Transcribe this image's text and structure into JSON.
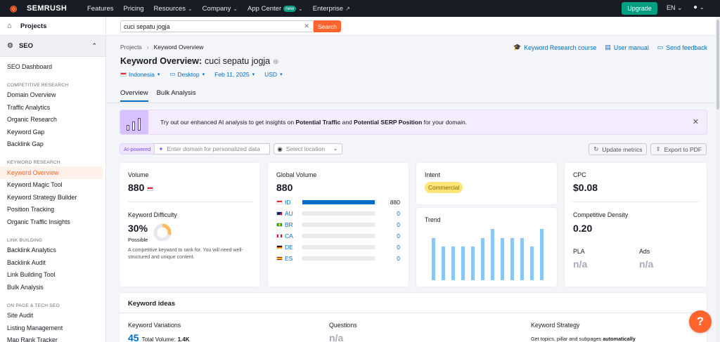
{
  "topbar": {
    "brand": "SEMRUSH",
    "nav": [
      {
        "label": "Features",
        "dropdown": false
      },
      {
        "label": "Pricing",
        "dropdown": false
      },
      {
        "label": "Resources",
        "dropdown": true
      },
      {
        "label": "Company",
        "dropdown": true
      },
      {
        "label": "App Center",
        "dropdown": true,
        "badge": "new"
      },
      {
        "label": "Enterprise",
        "dropdown": false
      }
    ],
    "upgrade_label": "Upgrade",
    "lang": "EN"
  },
  "sidebar": {
    "projects": "Projects",
    "seo": "SEO",
    "top_items": [
      "SEO Dashboard"
    ],
    "sections": [
      {
        "title": "COMPETITIVE RESEARCH",
        "items": [
          "Domain Overview",
          "Traffic Analytics",
          "Organic Research",
          "Keyword Gap",
          "Backlink Gap"
        ]
      },
      {
        "title": "KEYWORD RESEARCH",
        "items": [
          "Keyword Overview",
          "Keyword Magic Tool",
          "Keyword Strategy Builder",
          "Position Tracking",
          "Organic Traffic Insights"
        ]
      },
      {
        "title": "LINK BUILDING",
        "items": [
          "Backlink Analytics",
          "Backlink Audit",
          "Link Building Tool",
          "Bulk Analysis"
        ]
      },
      {
        "title": "ON PAGE & TECH SEO",
        "items": [
          "Site Audit",
          "Listing Management",
          "Map Rank Tracker"
        ]
      }
    ],
    "active_item": "Keyword Overview"
  },
  "search": {
    "value": "cuci sepatu jogja",
    "button": "Search"
  },
  "breadcrumb": {
    "parent": "Projects",
    "current": "Keyword Overview"
  },
  "toplinks": {
    "course": "Keyword Research course",
    "manual": "User manual",
    "feedback": "Send feedback"
  },
  "page": {
    "title": "Keyword Overview:",
    "keyword": "cuci sepatu jogja"
  },
  "filters": {
    "country": "Indonesia",
    "device": "Desktop",
    "date": "Feb 11, 2025",
    "currency": "USD"
  },
  "tabs": [
    "Overview",
    "Bulk Analysis"
  ],
  "banner": {
    "pre": "Try out our enhanced AI analysis to get insights on ",
    "b1": "Potential Traffic",
    "mid": " and ",
    "b2": "Potential SERP Position",
    "post": " for your domain."
  },
  "ai": {
    "pill": "AI-powered",
    "placeholder": "Enter domain for personalized data",
    "location": "Select location"
  },
  "actions": {
    "update": "Update metrics",
    "export": "Export to PDF"
  },
  "volume": {
    "label": "Volume",
    "value": "880"
  },
  "difficulty": {
    "label": "Keyword Difficulty",
    "value": "30%",
    "level": "Possible",
    "percent": 30,
    "desc": "A competitive keyword to rank for. You will need well-structured and unique content."
  },
  "global": {
    "label": "Global Volume",
    "value": "880",
    "rows": [
      {
        "code": "ID",
        "value": "880",
        "fraction": 1.0
      },
      {
        "code": "AU",
        "value": "0",
        "fraction": 0
      },
      {
        "code": "BR",
        "value": "0",
        "fraction": 0
      },
      {
        "code": "CA",
        "value": "0",
        "fraction": 0
      },
      {
        "code": "DE",
        "value": "0",
        "fraction": 0
      },
      {
        "code": "ES",
        "value": "0",
        "fraction": 0
      }
    ]
  },
  "intent": {
    "label": "Intent",
    "value": "Commercial"
  },
  "trend": {
    "label": "Trend",
    "values": [
      0.82,
      0.66,
      0.66,
      0.66,
      0.66,
      0.82,
      1.0,
      0.82,
      0.82,
      0.82,
      0.66,
      1.0
    ]
  },
  "cpc": {
    "label": "CPC",
    "value": "$0.08"
  },
  "density": {
    "label": "Competitive Density",
    "value": "0.20"
  },
  "pla": {
    "label": "PLA",
    "value": "n/a"
  },
  "ads": {
    "label": "Ads",
    "value": "n/a"
  },
  "ideas": {
    "title": "Keyword ideas",
    "variations": {
      "label": "Keyword Variations",
      "count": "45",
      "total_label": "Total Volume:",
      "total": "1.4K"
    },
    "questions": {
      "label": "Questions",
      "value": "n/a"
    },
    "strategy": {
      "label": "Keyword Strategy",
      "desc_pre": "Get topics, pillar and subpages ",
      "desc_bold": "automatically"
    }
  },
  "colors": {
    "brand": "#ff642d",
    "link": "#006dca",
    "upgrade": "#009f81"
  }
}
